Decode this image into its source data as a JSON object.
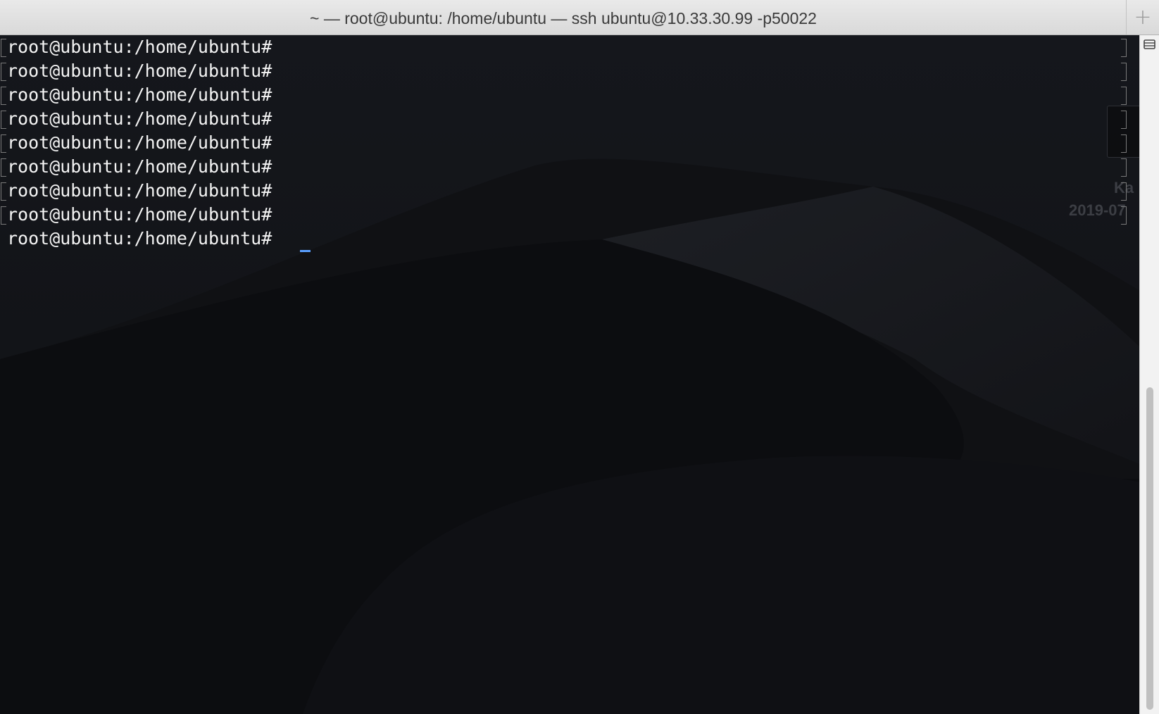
{
  "window": {
    "title": "~ — root@ubuntu: /home/ubuntu — ssh ubuntu@10.33.30.99 -p50022",
    "new_tab_label": "+"
  },
  "terminal": {
    "prompt_lines": [
      "root@ubuntu:/home/ubuntu#",
      "root@ubuntu:/home/ubuntu#",
      "root@ubuntu:/home/ubuntu#",
      "root@ubuntu:/home/ubuntu#",
      "root@ubuntu:/home/ubuntu#",
      "root@ubuntu:/home/ubuntu#",
      "root@ubuntu:/home/ubuntu#",
      "root@ubuntu:/home/ubuntu#",
      "root@ubuntu:/home/ubuntu#"
    ],
    "foreground_color": "#f4f4f4",
    "background_color": "#0d0e11",
    "cursor_color": "#5aa0ff"
  },
  "desktop_peek": {
    "name_fragment": "Ka",
    "date_fragment": "2019-07"
  },
  "icons": {
    "new_tab": "plus-icon",
    "scrollbar_marks": "marks-icon"
  }
}
